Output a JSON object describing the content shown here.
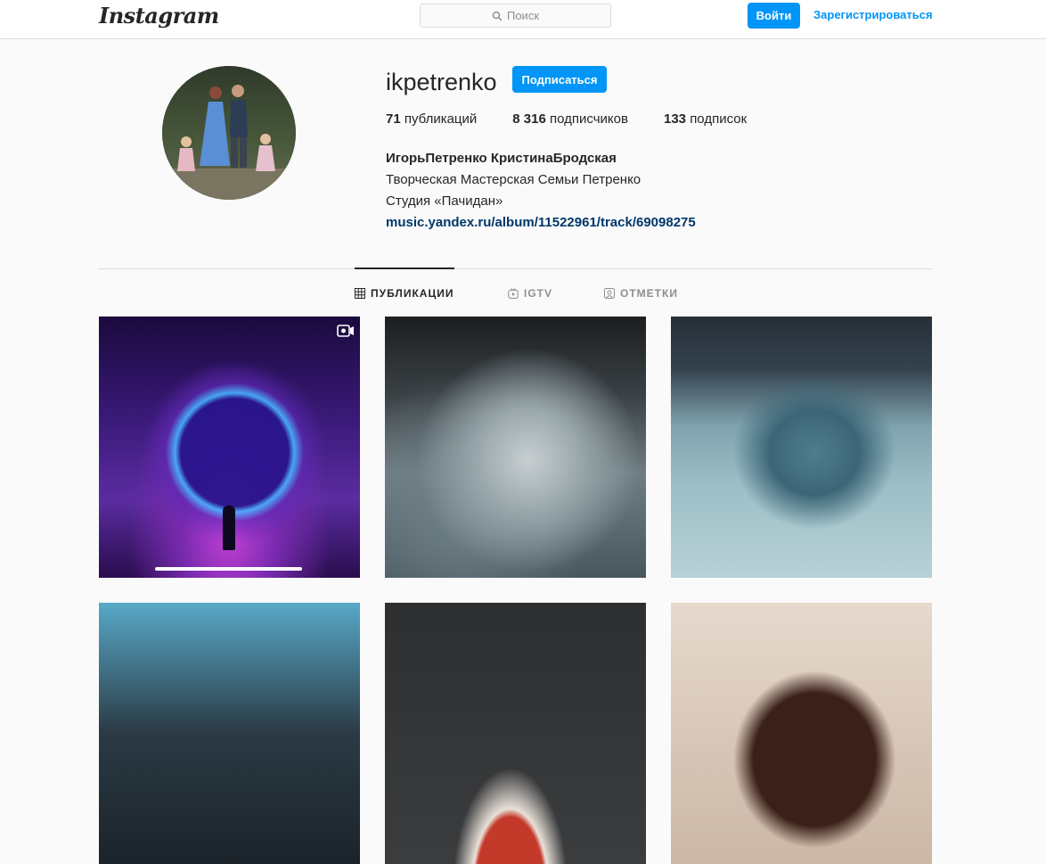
{
  "header": {
    "logo_text": "Instagram",
    "search_placeholder": "Поиск",
    "login_label": "Войти",
    "signup_label": "Зарегистрироваться"
  },
  "profile": {
    "username": "ikpetrenko",
    "follow_label": "Подписаться",
    "stats": {
      "posts_count": "71",
      "posts_label": "публикаций",
      "followers_count": "8 316",
      "followers_label": "подписчиков",
      "following_count": "133",
      "following_label": "подписок"
    },
    "bio": {
      "full_name": "ИгорьПетренко КристинаБродская",
      "line1": "Творческая Мастерская Семьи Петренко",
      "line2": "Студия «Пачидан»",
      "link": "music.yandex.ru/album/11522961/track/69098275"
    }
  },
  "tabs": [
    {
      "label": "ПУБЛИКАЦИИ",
      "icon": "grid-icon",
      "active": true
    },
    {
      "label": "IGTV",
      "icon": "igtv-icon",
      "active": false
    },
    {
      "label": "ОТМЕТКИ",
      "icon": "tagged-icon",
      "active": false
    }
  ],
  "colors": {
    "accent": "#0095f6",
    "link": "#00376b",
    "text": "#262626",
    "muted": "#8e8e8e",
    "border": "#dbdbdb",
    "background": "#fafafa"
  }
}
